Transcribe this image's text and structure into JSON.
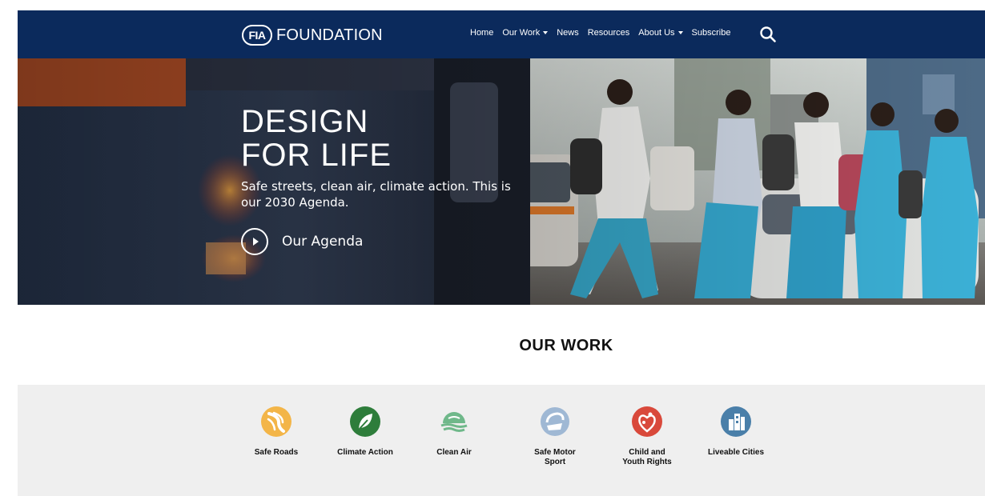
{
  "header": {
    "logo_badge": "FIA",
    "logo_text": "FOUNDATION",
    "nav": [
      {
        "label": "Home"
      },
      {
        "label": "Our Work"
      },
      {
        "label": "News"
      },
      {
        "label": "Resources"
      },
      {
        "label": "About Us"
      },
      {
        "label": "Subscribe"
      }
    ],
    "search_icon": "search-icon"
  },
  "hero": {
    "title": "DESIGN\nFOR LIFE",
    "subtitle": "Safe streets, clean air, climate action. This is our 2030 Agenda.",
    "cta_label": "Our Agenda",
    "cta_icon": "play-circle-icon"
  },
  "our_work": {
    "title": "OUR WORK",
    "items": [
      {
        "label": "Safe Roads",
        "icon": "safe-roads-icon",
        "color": "#f3b548"
      },
      {
        "label": "Climate Action",
        "icon": "climate-action-icon",
        "color": "#2e7d3b"
      },
      {
        "label": "Clean Air",
        "icon": "clean-air-icon",
        "color": "#6fb88a"
      },
      {
        "label": "Safe Motor\nSport",
        "icon": "safe-motor-sport-icon",
        "color": "#9fb8d4"
      },
      {
        "label": "Child and\nYouth Rights",
        "icon": "child-youth-rights-icon",
        "color": "#d9493b"
      },
      {
        "label": "Liveable Cities",
        "icon": "liveable-cities-icon",
        "color": "#4a7fa9"
      }
    ]
  },
  "colors": {
    "navbar": "#0b2a5c",
    "band": "#efefef"
  }
}
